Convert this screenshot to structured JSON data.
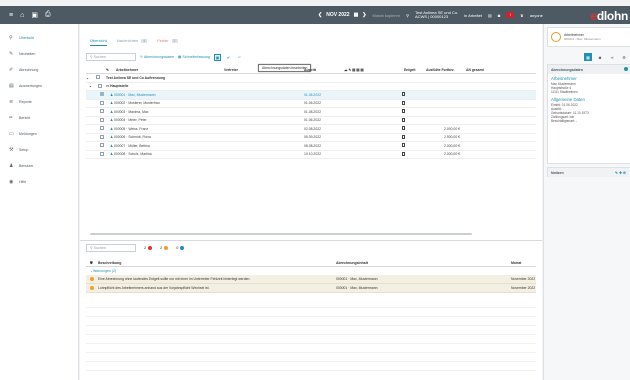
{
  "topbar": {
    "period": "NOV 2022",
    "copy_label": "Monat kopieren",
    "company": "Test Anlinea SE und Co.",
    "company_sub": "ACWS | 00000123",
    "mandant_label": "in Arbeitet",
    "user": "anyone",
    "logo_e": "e",
    "logo_rest": "dlohn"
  },
  "sidebar": {
    "items": [
      {
        "label": "Übersicht",
        "icon": "location-icon",
        "glyph": "⚲"
      },
      {
        "label": "Neuheiten",
        "icon": "pencil-icon",
        "glyph": "✎"
      },
      {
        "label": "Abrechnung",
        "icon": "edit-icon",
        "glyph": "✐"
      },
      {
        "label": "Auswertungen",
        "icon": "report-icon",
        "glyph": "▤"
      },
      {
        "label": "Reporte",
        "icon": "chart-icon",
        "glyph": "≋"
      },
      {
        "label": "Bericht",
        "icon": "pen-icon",
        "glyph": "✏"
      },
      {
        "label": "Meldungen",
        "icon": "folder-icon",
        "glyph": "▭"
      },
      {
        "label": "Setup",
        "icon": "wrench-icon",
        "glyph": "⚒"
      },
      {
        "label": "Benutzer",
        "icon": "person-icon",
        "glyph": "♟"
      },
      {
        "label": "Hilfe",
        "icon": "globe-icon",
        "glyph": "◉"
      }
    ]
  },
  "main": {
    "tabs": [
      {
        "label": "Übersicht",
        "count": ""
      },
      {
        "label": "Nachrichten",
        "count": "4"
      },
      {
        "label": "Fehler",
        "count": "2"
      }
    ],
    "search_placeholder": "Suchen",
    "link_abrechnungsdaten": "Abrechnungsdaten",
    "link_schnellerfassung": "Schnellerfassung",
    "tooltip": "Abrechnungsdaten bearbeiten",
    "grid_headers": [
      "Arbeitnehmer",
      "Vertreter",
      "Austritt",
      "Entgelt",
      "Ausfüllte Fortbez.",
      "AN gesamt"
    ],
    "group_label": "Test Anlinea SE und Co Auftrennung",
    "subgroup_label": "Hauptstelle",
    "rows": [
      {
        "name": "000001 · Max, Mustermann",
        "date": "01.06.2022",
        "entgelt": "",
        "sel": true
      },
      {
        "name": "000002 · Musterer, Musterfrau",
        "date": "01.06.2022",
        "entgelt": "",
        "sel": false
      },
      {
        "name": "000003 · Maxima, Max",
        "date": "01.08.2022",
        "entgelt": "",
        "sel": false
      },
      {
        "name": "000004 · Meier, Peter",
        "date": "01.06.2022",
        "entgelt": "",
        "sel": false
      },
      {
        "name": "000005 · Weiss, Franz",
        "date": "02.08.2022",
        "entgelt": "2.000,00 €",
        "sel": false
      },
      {
        "name": "000006 · Schmidt, Fiona",
        "date": "05.09.2022",
        "entgelt": "2.500,00 €",
        "sel": false
      },
      {
        "name": "000007 · Müller, Bettina",
        "date": "08.08.2022",
        "entgelt": "2.000,00 €",
        "sel": false
      },
      {
        "name": "000008 · Schulz, Martina",
        "date": "10.10.2022",
        "entgelt": "2.000,00 €",
        "sel": false
      }
    ],
    "bottom_search_placeholder": "Suchen",
    "counters": [
      {
        "value": "2",
        "color": "#e0312b"
      },
      {
        "value": "2",
        "color": "#f0a12b"
      },
      {
        "value": "0",
        "color": "#1f8fb3"
      }
    ],
    "msg_headers": [
      "Beschreibung",
      "Abrechnungsinhalt",
      "Monat"
    ],
    "msg_group": "Warnungen (2)",
    "messages": [
      {
        "text": "Eine Abrechnung ohne laufendes Entgelt sollte nur mit einer im Unterreiter Fehlzeit hinterlegt werden.",
        "who": "000001 · Max, Mustermann",
        "month": "November 2022"
      },
      {
        "text": "Lohnpflicht des Arbeitnehmers anhand aus der Vorjahrspflicht Wechsel ist.",
        "who": "000001 · Max, Mustermann",
        "month": "November 2022"
      }
    ]
  },
  "right": {
    "card_title": "Arbeitnehmer",
    "card_sub": "000001 · Max, Mustermann",
    "box_title": "Abrechnungsdaten",
    "sec1": "Arbeitnehmer",
    "sec1_lines": [
      "Max Mustermann",
      "Hauptstraße 4",
      "11111 Stadtheimen"
    ],
    "sec2": "Allgemeine Daten",
    "sec2_lines": [
      "Eintritt: 01.06.2022",
      "Austritt: -",
      "Geburtsdatum: 11.10.1973",
      "Zahlungsart: bar",
      "Beschäftigtenart: -"
    ],
    "notes_title": "Notizen"
  }
}
